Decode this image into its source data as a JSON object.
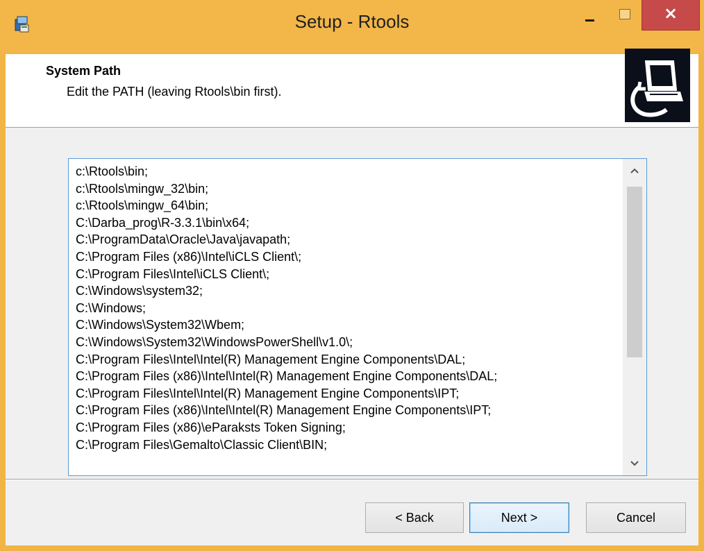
{
  "window": {
    "title": "Setup - Rtools",
    "close_label": "×"
  },
  "header": {
    "title": "System Path",
    "subtitle": "Edit the PATH (leaving Rtools\\bin first)."
  },
  "path_lines": [
    "c:\\Rtools\\bin;",
    "c:\\Rtools\\mingw_32\\bin;",
    "c:\\Rtools\\mingw_64\\bin;",
    "C:\\Darba_prog\\R-3.3.1\\bin\\x64;",
    "C:\\ProgramData\\Oracle\\Java\\javapath;",
    "C:\\Program Files (x86)\\Intel\\iCLS Client\\;",
    "C:\\Program Files\\Intel\\iCLS Client\\;",
    "C:\\Windows\\system32;",
    "C:\\Windows;",
    "C:\\Windows\\System32\\Wbem;",
    "C:\\Windows\\System32\\WindowsPowerShell\\v1.0\\;",
    "C:\\Program Files\\Intel\\Intel(R) Management Engine Components\\DAL;",
    "C:\\Program Files (x86)\\Intel\\Intel(R) Management Engine Components\\DAL;",
    "C:\\Program Files\\Intel\\Intel(R) Management Engine Components\\IPT;",
    "C:\\Program Files (x86)\\Intel\\Intel(R) Management Engine Components\\IPT;",
    "C:\\Program Files (x86)\\eParaksts Token Signing;",
    "C:\\Program Files\\Gemalto\\Classic Client\\BIN;"
  ],
  "buttons": {
    "back": "< Back",
    "next": "Next >",
    "cancel": "Cancel"
  },
  "icons": {
    "app": "installer-icon",
    "logo": "computer-install-icon",
    "scroll_up": "chevron-up-icon",
    "scroll_down": "chevron-down-icon"
  },
  "colors": {
    "titlebar": "#f2b649",
    "close_button": "#c74a4a",
    "textbox_border": "#5a9ad6",
    "next_button_border": "#3c7fb1"
  }
}
